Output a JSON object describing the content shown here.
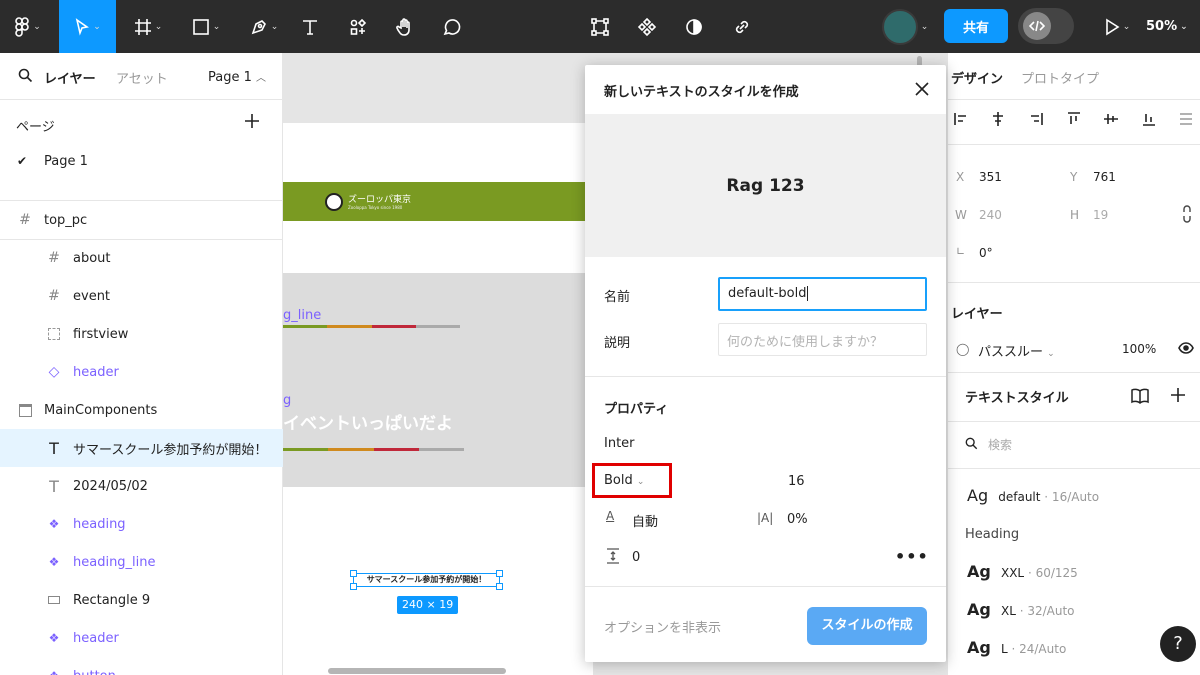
{
  "toolbar": {
    "share_label": "共有",
    "zoom_label": "50%",
    "avatar_color": "#2f6b6b",
    "accent": "#18a0fb"
  },
  "left_panel": {
    "tab_layers": "レイヤー",
    "tab_assets": "アセット",
    "page_selector": "Page 1",
    "pages_heading": "ページ",
    "pages": [
      "Page 1"
    ],
    "layers": [
      {
        "label": "top_pc",
        "icon": "frame-icon"
      },
      {
        "label": "about",
        "icon": "frame-icon"
      },
      {
        "label": "event",
        "icon": "frame-icon"
      },
      {
        "label": "firstview",
        "icon": "section-dashed-icon"
      },
      {
        "label": "header",
        "icon": "instance-icon"
      },
      {
        "label": "MainComponents",
        "icon": "section-icon"
      },
      {
        "label": "サマースクール参加予約が開始！",
        "icon": "text-icon"
      },
      {
        "label": "2024/05/02",
        "icon": "text-icon"
      },
      {
        "label": "heading",
        "icon": "component-icon"
      },
      {
        "label": "heading_line",
        "icon": "component-icon"
      },
      {
        "label": "Rectangle 9",
        "icon": "rectangle-icon"
      },
      {
        "label": "header",
        "icon": "component-icon"
      },
      {
        "label": "button",
        "icon": "component-icon"
      }
    ]
  },
  "canvas": {
    "banner_logo_text": "ズーロッパ東京",
    "banner_logo_sub": "Zooloppa Tokyo since 1980",
    "heading_line_fragment": "g_line",
    "heading_fragment": "g",
    "event_text": "イベントいっぱいだよ",
    "selected_text": "サマースクール参加予約が開始！",
    "size_badge": "240 × 19",
    "banner_color": "#7a9a22"
  },
  "modal": {
    "title": "新しいテキストのスタイルを作成",
    "preview": "Rag 123",
    "name_label": "名前",
    "name_value": "default-bold",
    "desc_label": "説明",
    "desc_placeholder": "何のために使用しますか？",
    "properties_heading": "プロパティ",
    "font_family": "Inter",
    "font_weight": "Bold",
    "font_size": "16",
    "line_height": "自動",
    "letter_spacing": "0%",
    "paragraph_spacing": "0",
    "hide_options": "オプションを非表示",
    "create_button": "スタイルの作成"
  },
  "right_panel": {
    "tab_design": "デザイン",
    "tab_prototype": "プロトタイプ",
    "x_label": "X",
    "x_value": "351",
    "y_label": "Y",
    "y_value": "761",
    "w_label": "W",
    "w_value": "240",
    "h_label": "H",
    "h_value": "19",
    "rotation": "0°",
    "layer_heading": "レイヤー",
    "blend_mode": "パススルー",
    "opacity": "100%",
    "text_styles_heading": "テキストスタイル",
    "search_placeholder": "検索",
    "styles": [
      {
        "glyph": "Ag",
        "name": "default",
        "meta": " · 16/Auto",
        "bold": false
      },
      {
        "glyph": "Ag",
        "name": "XXL",
        "meta": " · 60/125",
        "bold": true
      },
      {
        "glyph": "Ag",
        "name": "XL",
        "meta": " · 32/Auto",
        "bold": true
      },
      {
        "glyph": "Ag",
        "name": "L",
        "meta": " · 24/Auto",
        "bold": true
      }
    ],
    "styles_group": "Heading",
    "help": "?"
  }
}
